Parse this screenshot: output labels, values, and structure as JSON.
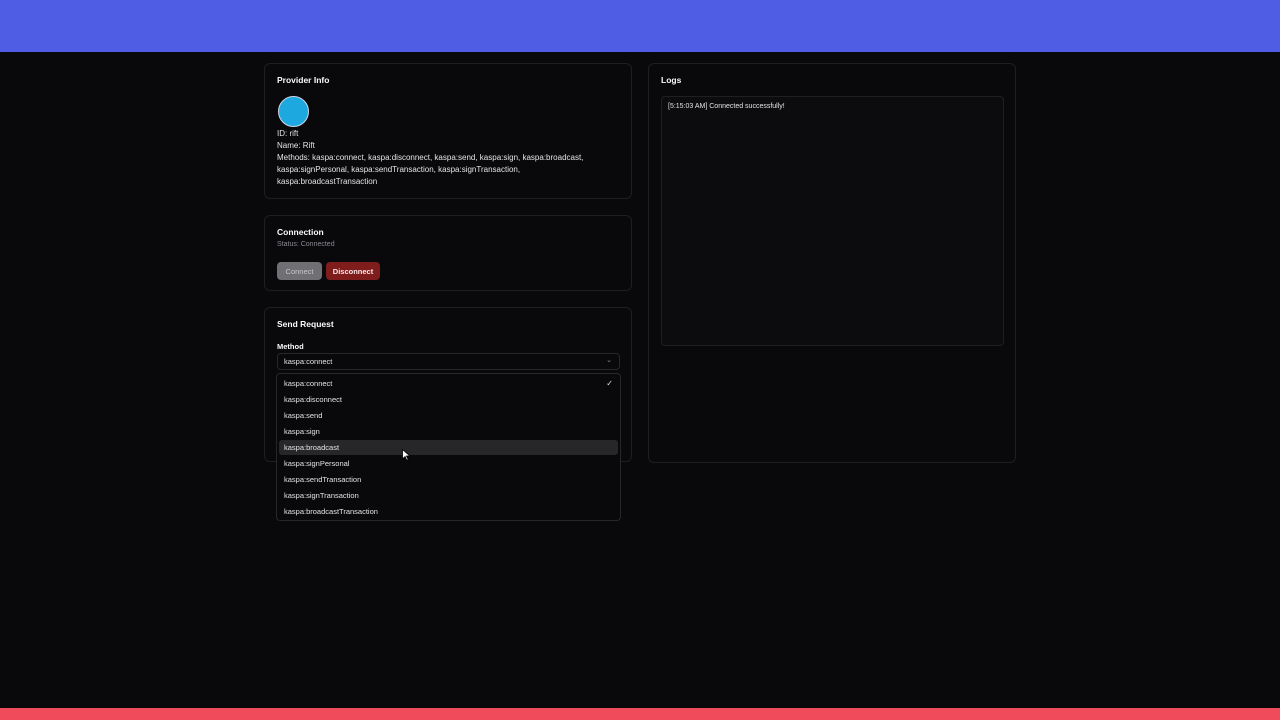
{
  "provider_info": {
    "title": "Provider Info",
    "id_line": "ID: rift",
    "name_line": "Name: Rift",
    "methods_line": "Methods: kaspa:connect, kaspa:disconnect, kaspa:send, kaspa:sign, kaspa:broadcast, kaspa:signPersonal, kaspa:sendTransaction, kaspa:signTransaction, kaspa:broadcastTransaction",
    "avatar_color": "#1da9e0"
  },
  "connection": {
    "title": "Connection",
    "status": "Status: Connected",
    "connect_label": "Connect",
    "disconnect_label": "Disconnect"
  },
  "send_request": {
    "title": "Send Request",
    "method_label": "Method",
    "selected_method": "kaspa:connect",
    "options": [
      {
        "label": "kaspa:connect",
        "selected": true
      },
      {
        "label": "kaspa:disconnect"
      },
      {
        "label": "kaspa:send"
      },
      {
        "label": "kaspa:sign"
      },
      {
        "label": "kaspa:broadcast",
        "highlighted": true
      },
      {
        "label": "kaspa:signPersonal"
      },
      {
        "label": "kaspa:sendTransaction"
      },
      {
        "label": "kaspa:signTransaction"
      },
      {
        "label": "kaspa:broadcastTransaction"
      }
    ]
  },
  "logs": {
    "title": "Logs",
    "entries": [
      "[5:15:03 AM] Connected successfully!"
    ]
  },
  "colors": {
    "top_bar": "#4f5de4",
    "bottom_bar": "#ef4b5b",
    "disconnect": "#7f1d1d"
  }
}
